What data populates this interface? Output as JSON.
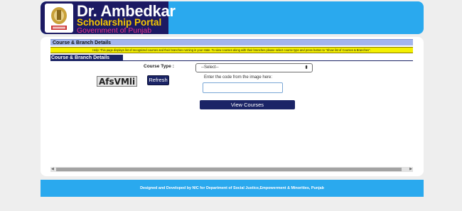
{
  "header": {
    "title": "Dr. Ambedkar",
    "subtitle": "Scholarship Portal",
    "org": "Government of Punjab"
  },
  "form": {
    "section_title": "Course & Branch Details",
    "help_text": "Help: This page displays list of recognized courses and their branches running in your state. To view courses along with their branches please select course type and press button to \"Show list of Courses & Branches\".",
    "subsection_title": "Course & Branch Details",
    "course_type_label": "Course Type :",
    "course_type_selected": "--Select--",
    "captcha_text": "AfsVMli",
    "refresh_label": "Refresh",
    "code_label": "Enter the code from the image here:",
    "code_value": "",
    "view_button_label": "View Courses"
  },
  "footer": {
    "text": "Designed and Developed by NIC for Department of Social Justice,Empowerment & Minorities, Punjab"
  },
  "colors": {
    "brand_blue": "#2aa9ee",
    "navy": "#1b2466",
    "help_yellow": "#f4f000",
    "title_bar": "#a3b5ec"
  }
}
